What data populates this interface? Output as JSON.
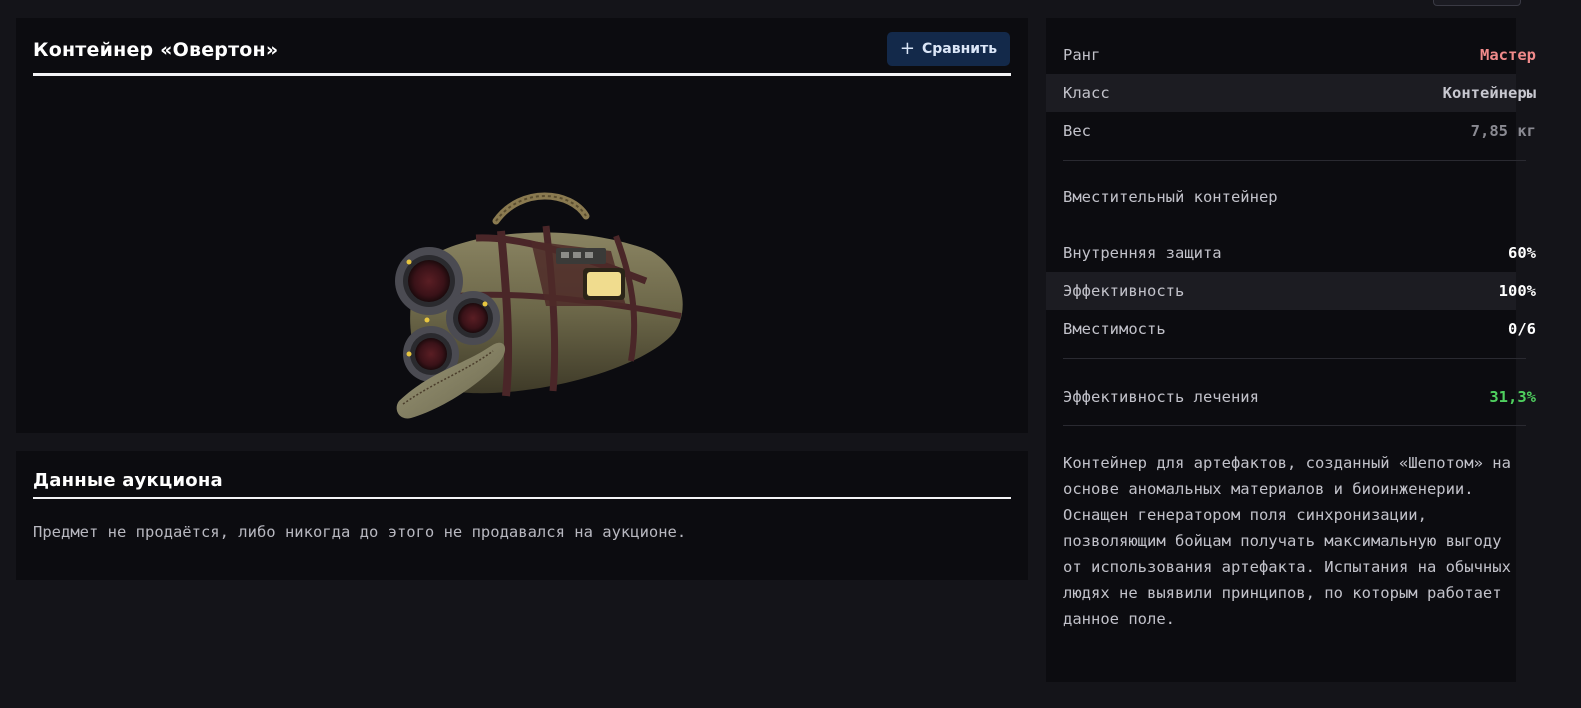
{
  "item": {
    "title": "Контейнер «Овертон»",
    "compare_label": "Сравнить",
    "compare_icon": "plus-icon"
  },
  "auction": {
    "title": "Данные аукциона",
    "text": "Предмет не продаётся, либо никогда до этого не продавался на аукционе."
  },
  "stats": {
    "rank": {
      "label": "Ранг",
      "value": "Мастер",
      "color": "#f08a8a"
    },
    "class": {
      "label": "Класс",
      "value": "Контейнеры",
      "color": "#c8c8d0"
    },
    "weight": {
      "label": "Вес",
      "value": "7,85 кг",
      "color": "#8a8a92"
    },
    "subtitle": "Вместительный контейнер",
    "protection": {
      "label": "Внутренняя защита",
      "value": "60%",
      "color": "#ffffff"
    },
    "efficiency": {
      "label": "Эффективность",
      "value": "100%",
      "color": "#ffffff"
    },
    "capacity": {
      "label": "Вместимость",
      "value": "0/6",
      "color": "#ffffff"
    },
    "healing": {
      "label": "Эффективность лечения",
      "value": "31,3%",
      "color": "#4fd05f"
    },
    "description": "Контейнер для артефактов, созданный «Шепотом» на основе аномальных материалов и биоинженерии. Оснащен генератором поля синхронизации, позволяющим бойцам получать максимальную выгоду от использования артефакта. Испытания на обычных людях не выявили принципов, по которым работает данное поле."
  }
}
